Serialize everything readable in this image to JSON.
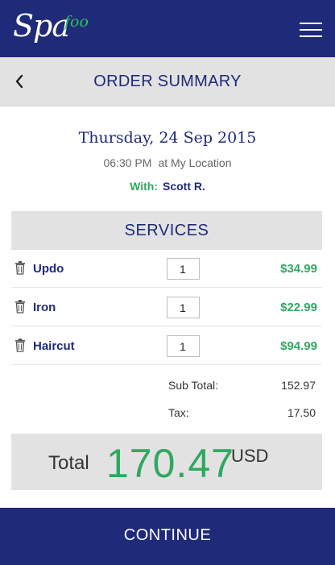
{
  "header": {
    "logo_main": "Spa",
    "logo_sub": "foo",
    "menu_icon": "hamburger-menu-icon"
  },
  "titlebar": {
    "back_icon": "chevron-left-icon",
    "title": "ORDER SUMMARY"
  },
  "appointment": {
    "date": "Thursday, 24 Sep 2015",
    "time": "06:30 PM",
    "location": "at My Location",
    "with_label": "With:",
    "with_name": "Scott R."
  },
  "services": {
    "header": "SERVICES",
    "items": [
      {
        "name": "Updo",
        "qty": "1",
        "price": "$34.99"
      },
      {
        "name": "Iron",
        "qty": "1",
        "price": "$22.99"
      },
      {
        "name": "Haircut",
        "qty": "1",
        "price": "$94.99"
      }
    ]
  },
  "summary": {
    "subtotal_label": "Sub Total:",
    "subtotal_value": "152.97",
    "tax_label": "Tax:",
    "tax_value": "17.50"
  },
  "total": {
    "label": "Total",
    "value": "170.47",
    "currency": "USD"
  },
  "footer": {
    "continue_label": "CONTINUE"
  },
  "colors": {
    "primary": "#1f2a78",
    "accent_green": "#2fa860",
    "panel_grey": "#e2e2e2"
  }
}
